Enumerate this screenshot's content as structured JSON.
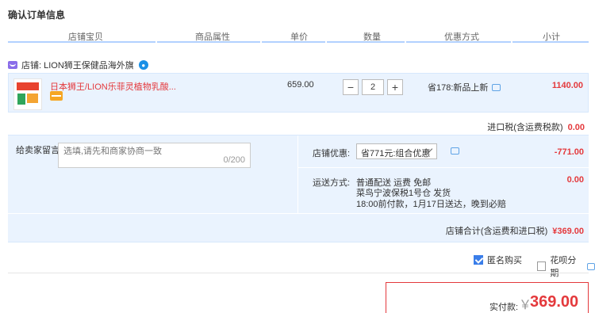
{
  "page": {
    "title": "确认订单信息"
  },
  "columns": [
    "店铺宝贝",
    "商品属性",
    "单价",
    "数量",
    "优惠方式",
    "小计"
  ],
  "shop": {
    "label": "店铺: LION狮王保健品海外旗"
  },
  "item": {
    "name": "日本狮王/LION乐菲灵植物乳酸...",
    "price": "659.00",
    "quantity": "2",
    "minus": "−",
    "plus": "+",
    "promo": "省178:新品上新",
    "subtotal": "1140.00"
  },
  "tax": {
    "label": "进口税(含运费税款)",
    "value": "0.00"
  },
  "message": {
    "label": "给卖家留言:",
    "placeholder": "选填,请先和商家协商一致",
    "count": "0/200"
  },
  "shop_discount": {
    "label": "店铺优惠:",
    "selected": "省771元:组合优惠",
    "value": "-771.00"
  },
  "shipping": {
    "label": "运送方式:",
    "line1": "普通配送 运费 免邮",
    "line2": "菜鸟宁波保税1号仓   发货",
    "line3": "18:00前付款，1月17日送达，晚到必赔",
    "value": "0.00"
  },
  "shop_total": {
    "label": "店铺合计(含运费和进口税)",
    "value": "¥369.00"
  },
  "options": {
    "anonymous": {
      "label": "匿名购买",
      "checked": true
    },
    "huabei": {
      "label": "花呗分期",
      "checked": false
    }
  },
  "payment": {
    "label": "实付款:",
    "currency": "￥",
    "amount": "369.00"
  },
  "colors": {
    "accent": "#e4393c",
    "panel": "#eaf3fe",
    "header_line": "#b2d1ff",
    "link": "#3a7ee9"
  }
}
